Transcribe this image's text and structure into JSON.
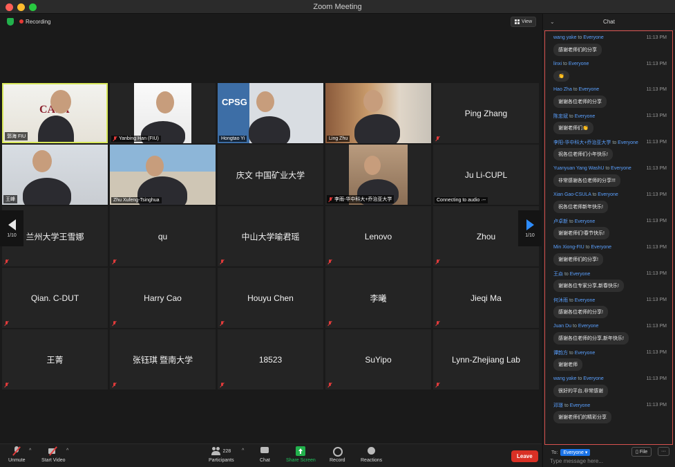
{
  "window": {
    "title": "Zoom Meeting"
  },
  "status": {
    "recording_label": "Recording",
    "view_label": "View"
  },
  "colors": {
    "accent": "#2d8cff",
    "leave": "#d93025",
    "share": "#22b14c",
    "active_speaker": "#d8e85a"
  },
  "tiles": [
    {
      "kind": "photo",
      "photo": "guo",
      "label": "郭海 FIU",
      "muted": false,
      "active": true
    },
    {
      "kind": "photo",
      "photo": "yan",
      "label": "Yanbing Han (FIU)",
      "muted": true
    },
    {
      "kind": "photo",
      "photo": "hong",
      "label": "Hongtao Yi",
      "muted": false
    },
    {
      "kind": "photo",
      "photo": "ling",
      "label": "Ling Zhu",
      "muted": false
    },
    {
      "kind": "name",
      "name": "Ping Zhang",
      "muted": true
    },
    {
      "kind": "photo",
      "photo": "wang",
      "label": "王峰",
      "muted": false
    },
    {
      "kind": "photo",
      "photo": "zhu",
      "label": "Zhu Xufeng-Tsinghua",
      "muted": false
    },
    {
      "kind": "name",
      "name": "庆文 中国矿业大学",
      "muted": false
    },
    {
      "kind": "photo",
      "photo": "li",
      "label": "李雨-华中科大+乔治亚大学",
      "muted": true
    },
    {
      "kind": "name",
      "name": "Ju Li-CUPL",
      "label": "Connecting to audio ·--",
      "muted": false
    },
    {
      "kind": "name",
      "name": "兰州大学王雪娜",
      "muted": true
    },
    {
      "kind": "name",
      "name": "qu",
      "muted": true
    },
    {
      "kind": "name",
      "name": "中山大学喻君瑶",
      "muted": true
    },
    {
      "kind": "name",
      "name": "Lenovo",
      "muted": true
    },
    {
      "kind": "name",
      "name": "Zhou",
      "muted": true
    },
    {
      "kind": "name",
      "name": "Qian. C-DUT",
      "muted": true
    },
    {
      "kind": "name",
      "name": "Harry Cao",
      "muted": true
    },
    {
      "kind": "name",
      "name": "Houyu Chen",
      "muted": true
    },
    {
      "kind": "name",
      "name": "李曦",
      "muted": true
    },
    {
      "kind": "name",
      "name": "Jieqi Ma",
      "muted": true
    },
    {
      "kind": "name",
      "name": "王菁",
      "muted": true
    },
    {
      "kind": "name",
      "name": "张钰琪 暨南大学",
      "muted": true
    },
    {
      "kind": "name",
      "name": "18523",
      "muted": true
    },
    {
      "kind": "name",
      "name": "SuYipo",
      "muted": true
    },
    {
      "kind": "name",
      "name": "Lynn-Zhejiang Lab",
      "muted": true
    }
  ],
  "photo_text": {
    "cpsg": "CPSG",
    "casa": "CASA"
  },
  "pagination": {
    "left": "1/10",
    "right": "1/10"
  },
  "toolbar": {
    "unmute": "Unmute",
    "start_video": "Start Video",
    "participants": "Participants",
    "participants_count": "228",
    "chat": "Chat",
    "share_screen": "Share Screen",
    "record": "Record",
    "reactions": "Reactions",
    "leave": "Leave"
  },
  "chat": {
    "title": "Chat",
    "to_word": "to",
    "messages": [
      {
        "sender": "wang yake",
        "target": "Everyone",
        "time": "11:13 PM",
        "text": "感谢老师们的分享"
      },
      {
        "sender": "linxi",
        "target": "Everyone",
        "time": "11:13 PM",
        "text": "👏"
      },
      {
        "sender": "Hao Zha",
        "target": "Everyone",
        "time": "11:13 PM",
        "text": "谢谢各位老师的分享"
      },
      {
        "sender": "陈忠斌",
        "target": "Everyone",
        "time": "11:13 PM",
        "text": "谢谢老师们👏"
      },
      {
        "sender": "李阳-华中科大+乔治亚大学",
        "target": "Everyone",
        "time": "11:13 PM",
        "text": "祝各位老师们小年快乐!"
      },
      {
        "sender": "Yuanyuan Yang WashU",
        "target": "Everyone",
        "time": "11:13 PM",
        "text": "非常感谢各位老师的分享!!!"
      },
      {
        "sender": "Xian Gao-CSULA",
        "target": "Everyone",
        "time": "11:13 PM",
        "text": "祝各位老师新年快乐!"
      },
      {
        "sender": "卢卓新",
        "target": "Everyone",
        "time": "11:13 PM",
        "text": "谢谢老师们!春节快乐!"
      },
      {
        "sender": "Min Xiong-FIU",
        "target": "Everyone",
        "time": "11:13 PM",
        "text": "谢谢老师们的分享!"
      },
      {
        "sender": "王焱",
        "target": "Everyone",
        "time": "11:13 PM",
        "text": "谢谢各位专家分享,新春快乐!"
      },
      {
        "sender": "何沐雨",
        "target": "Everyone",
        "time": "11:13 PM",
        "text": "感谢各位老师的分享!"
      },
      {
        "sender": "Juan Du",
        "target": "Everyone",
        "time": "11:13 PM",
        "text": "感谢各位老师的分享,新年快乐!"
      },
      {
        "sender": "谭韵方",
        "target": "Everyone",
        "time": "11:13 PM",
        "text": "谢谢老师"
      },
      {
        "sender": "wang yake",
        "target": "Everyone",
        "time": "11:13 PM",
        "text": "很好的平台,非常感谢"
      },
      {
        "sender": "邓璟",
        "target": "Everyone",
        "time": "11:13 PM",
        "text": "谢谢老师们的精彩分享"
      }
    ],
    "to_label": "To:",
    "to_target": "Everyone ▾",
    "file_label": "File",
    "more_label": "···",
    "input_placeholder": "Type message here..."
  }
}
